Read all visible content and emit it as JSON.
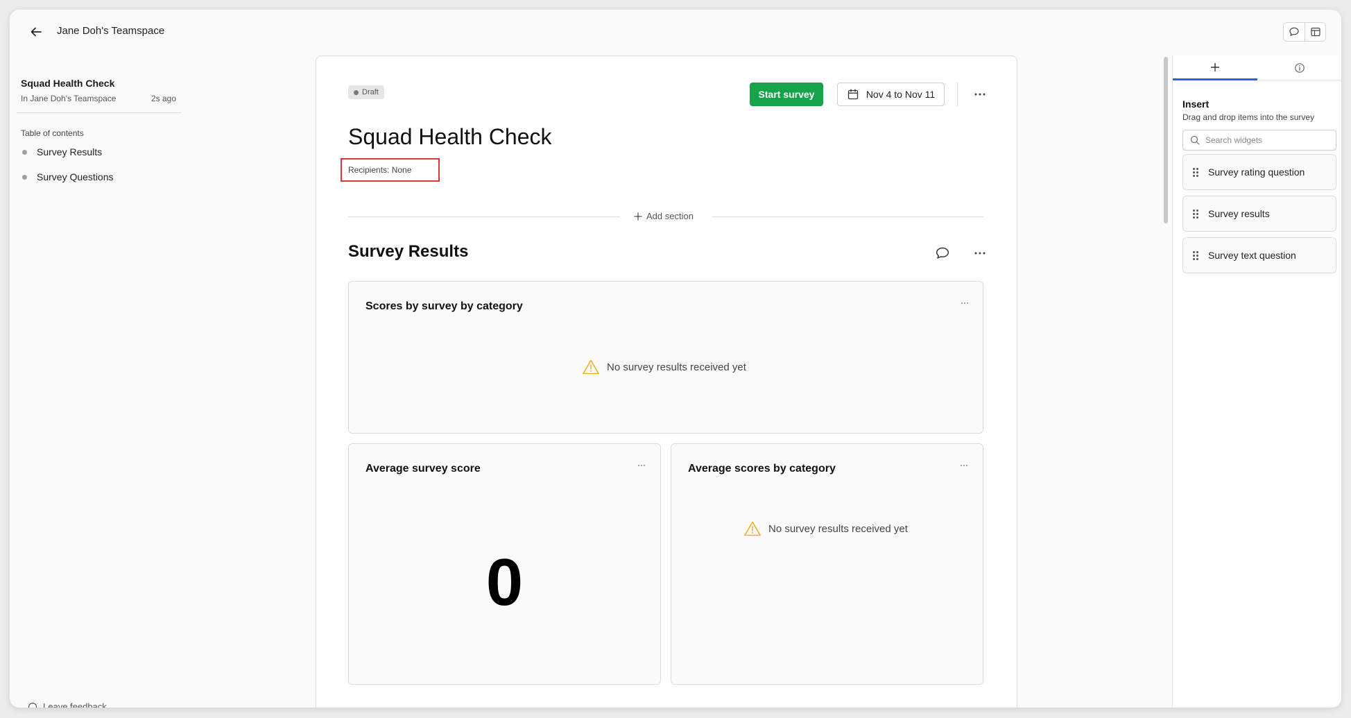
{
  "header": {
    "back_icon": "arrow-left-icon",
    "title": "Jane Doh's Teamspace",
    "actions": [
      {
        "icon": "comment-icon"
      },
      {
        "icon": "panel-layout-icon"
      }
    ]
  },
  "sidebar": {
    "doc_name": "Squad Health Check",
    "doc_location": "In Jane Doh's Teamspace",
    "doc_time": "2s ago",
    "toc_title": "Table of contents",
    "toc_items": [
      {
        "label": "Survey Results"
      },
      {
        "label": "Survey Questions"
      }
    ],
    "footer_label": "Leave feedback"
  },
  "document": {
    "status_badge": "Draft",
    "start_button": "Start survey",
    "date_range": "Nov 4 to Nov 11",
    "title": "Squad Health Check",
    "recipients": "Recipients: None",
    "add_section": "Add section",
    "section_title": "Survey Results",
    "widgets": {
      "scores_by_category": {
        "title": "Scores by survey by category",
        "empty_message": "No survey results received yet"
      },
      "average_score": {
        "title": "Average survey score",
        "value": "0"
      },
      "average_by_category": {
        "title": "Average scores by category",
        "empty_message": "No survey results received yet"
      }
    }
  },
  "right_panel": {
    "tabs": [
      {
        "icon": "plus-icon",
        "active": true
      },
      {
        "icon": "info-icon",
        "active": false
      }
    ],
    "insert_title": "Insert",
    "insert_subtitle": "Drag and drop items into the survey",
    "search_placeholder": "Search widgets",
    "items": [
      {
        "label": "Survey rating question"
      },
      {
        "label": "Survey results"
      },
      {
        "label": "Survey text question"
      }
    ]
  },
  "colors": {
    "accent_green": "#16a34a",
    "tab_active_blue": "#2563eb",
    "highlight_red": "#e0303a",
    "warning_amber": "#f2b01e"
  }
}
